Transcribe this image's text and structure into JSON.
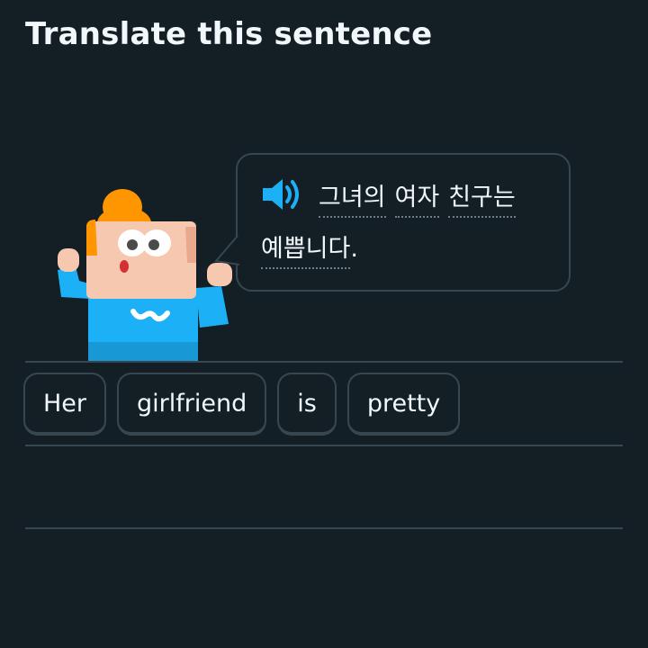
{
  "header": {
    "title": "Translate this sentence"
  },
  "prompt": {
    "speaker_icon": "speaker-icon",
    "words": [
      "그녀의",
      "여자",
      "친구는",
      "예쁩니다"
    ],
    "punctuation": "."
  },
  "answer_tiles": [
    "Her",
    "girlfriend",
    "is",
    "pretty"
  ],
  "colors": {
    "background": "#131f24",
    "border": "#37464f",
    "text": "#f1f7fb",
    "speaker": "#1cb0f6",
    "shirt": "#1cb0f6",
    "hair": "#ff9600",
    "skin": "#f7c8b0"
  }
}
